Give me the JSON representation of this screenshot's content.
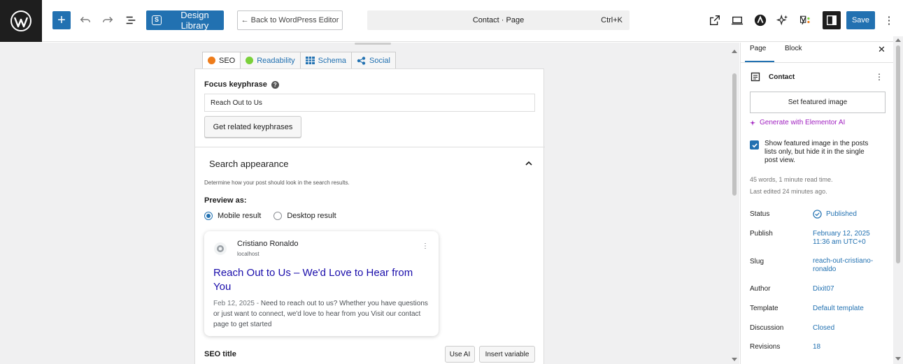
{
  "topbar": {
    "design_library_label": "Design Library",
    "back_label": "← Back to WordPress Editor",
    "command_title": "Contact · Page",
    "command_shortcut": "Ctrl+K",
    "save_label": "Save",
    "accent_color": "#2271b1",
    "icons": [
      "wordpress-logo-icon",
      "plus-icon",
      "undo-icon",
      "redo-icon",
      "document-overview-icon",
      "external-link-icon",
      "desktop-preview-icon",
      "elementor-ai-icon",
      "sparkle-icon",
      "yoast-icon",
      "sidebar-toggle-icon",
      "more-vertical-icon"
    ]
  },
  "yoast": {
    "tabs": [
      {
        "label": "SEO",
        "icon": "orange-face-icon"
      },
      {
        "label": "Readability",
        "icon": "green-face-icon"
      },
      {
        "label": "Schema",
        "icon": "grid-icon"
      },
      {
        "label": "Social",
        "icon": "share-icon"
      }
    ],
    "focus_keyphrase_label": "Focus keyphrase",
    "focus_keyphrase_value": "Reach Out to Us",
    "related_button_label": "Get related keyphrases",
    "search_appearance_title": "Search appearance",
    "search_appearance_desc": "Determine how your post should look in the search results.",
    "preview_as_label": "Preview as:",
    "mobile_label": "Mobile result",
    "desktop_label": "Desktop result",
    "selected_preview": "mobile",
    "serp": {
      "site_name": "Cristiano Ronaldo",
      "url": "localhost",
      "title": "Reach Out to Us – We'd Love to Hear from You",
      "date": "Feb 12, 2025",
      "separator": "-",
      "description": "Need to reach out to us? Whether you have questions or just want to connect, we'd love to hear from you Visit our contact page to get started"
    },
    "seo_title_label": "SEO title",
    "use_ai_label": "Use AI",
    "insert_variable_label": "Insert variable"
  },
  "sidebar": {
    "tab_page": "Page",
    "tab_block": "Block",
    "close_glyph": "✕",
    "doc_title": "Contact",
    "kebab_glyph": "⋮",
    "featured_button": "Set featured image",
    "generate_ai": "Generate with Elementor AI",
    "show_featured_text": "Show featured image in the posts lists only, but hide it in the single post view.",
    "show_featured_checked": true,
    "word_count": "45 words, 1 minute read time.",
    "last_edited": "Last edited 24 minutes ago.",
    "rows": [
      {
        "label": "Status",
        "value": "Published"
      },
      {
        "label": "Publish",
        "value": "February 12, 2025 11:36 am UTC+0"
      },
      {
        "label": "Slug",
        "value": "reach-out-cristiano-ronaldo"
      },
      {
        "label": "Author",
        "value": "Dixit07"
      },
      {
        "label": "Template",
        "value": "Default template"
      },
      {
        "label": "Discussion",
        "value": "Closed"
      },
      {
        "label": "Revisions",
        "value": "18"
      }
    ]
  }
}
